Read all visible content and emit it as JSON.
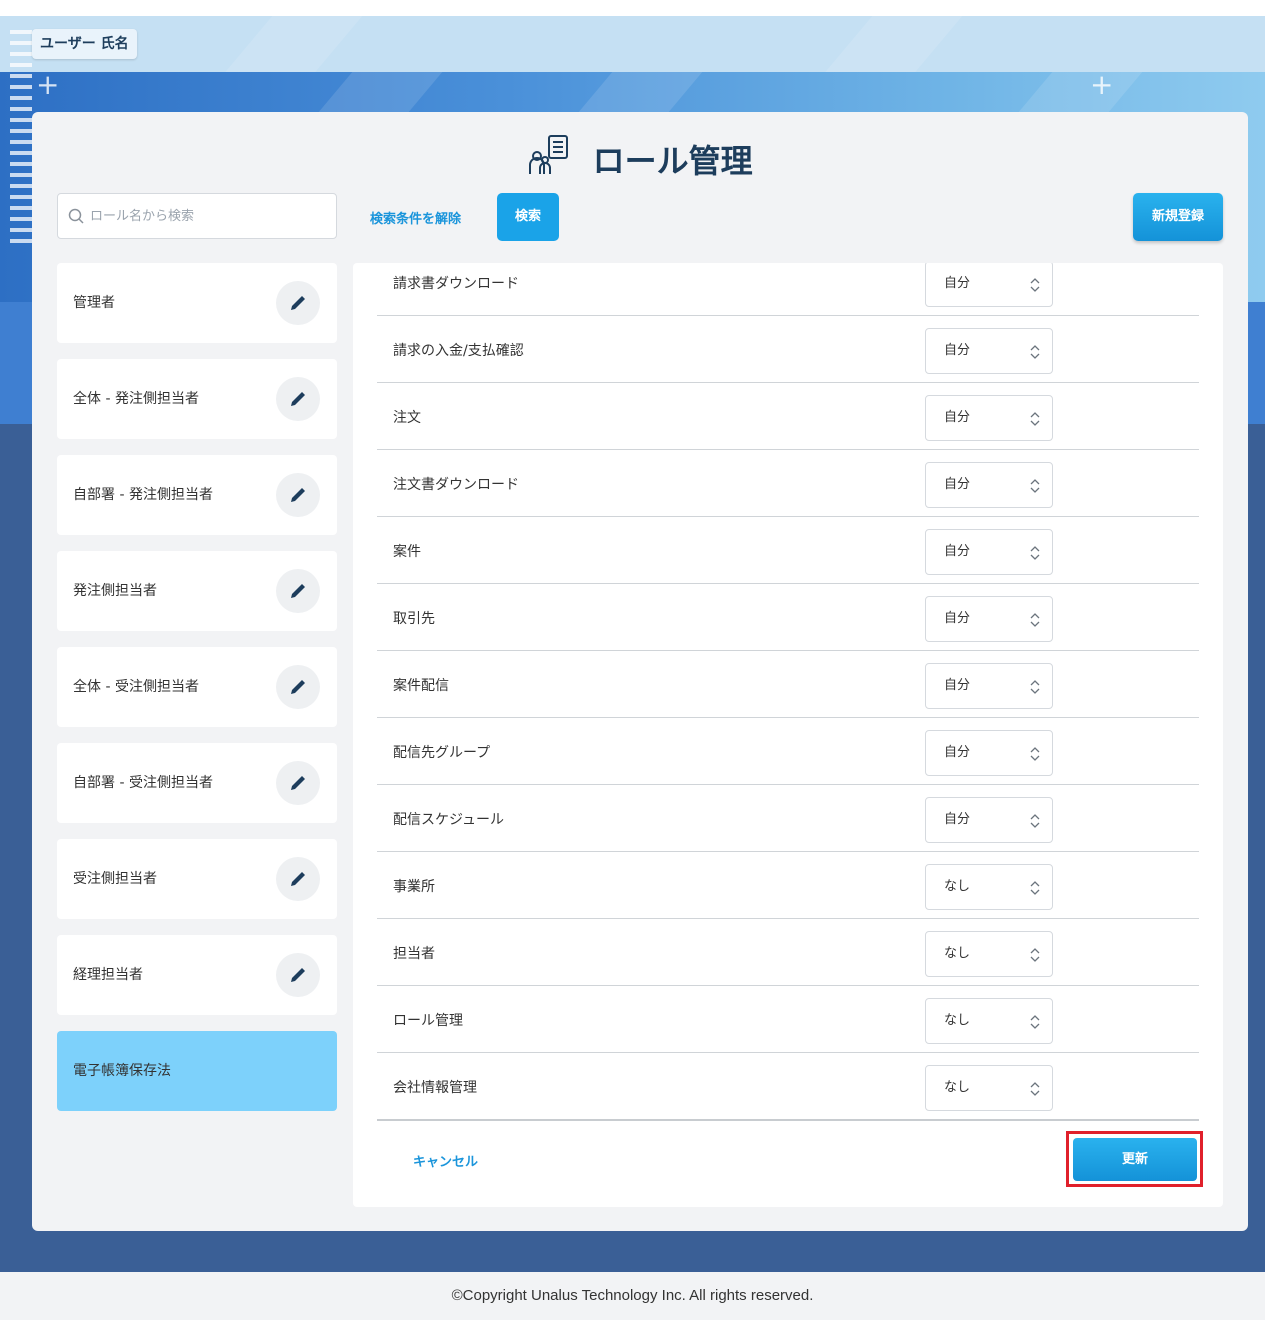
{
  "header": {
    "user_name": "ユーザー 氏名"
  },
  "page": {
    "title": "ロール管理"
  },
  "search": {
    "placeholder": "ロール名から検索",
    "value": "",
    "clear_label": "検索条件を解除",
    "search_label": "検索"
  },
  "toolbar": {
    "new_label": "新規登録"
  },
  "roles": [
    {
      "name": "管理者"
    },
    {
      "name": "全体 - 発注側担当者"
    },
    {
      "name": "自部署 - 発注側担当者"
    },
    {
      "name": "発注側担当者"
    },
    {
      "name": "全体 - 受注側担当者"
    },
    {
      "name": "自部署 - 受注側担当者"
    },
    {
      "name": "受注側担当者"
    },
    {
      "name": "経理担当者"
    },
    {
      "name": "電子帳簿保存法"
    }
  ],
  "selected_role": "電子帳簿保存法",
  "permissions": [
    {
      "label": "請求書ダウンロード",
      "value": "自分"
    },
    {
      "label": "請求の入金/支払確認",
      "value": "自分"
    },
    {
      "label": "注文",
      "value": "自分"
    },
    {
      "label": "注文書ダウンロード",
      "value": "自分"
    },
    {
      "label": "案件",
      "value": "自分"
    },
    {
      "label": "取引先",
      "value": "自分"
    },
    {
      "label": "案件配信",
      "value": "自分"
    },
    {
      "label": "配信先グループ",
      "value": "自分"
    },
    {
      "label": "配信スケジュール",
      "value": "自分"
    },
    {
      "label": "事業所",
      "value": "なし"
    },
    {
      "label": "担当者",
      "value": "なし"
    },
    {
      "label": "ロール管理",
      "value": "なし"
    },
    {
      "label": "会社情報管理",
      "value": "なし"
    }
  ],
  "actions": {
    "cancel_label": "キャンセル",
    "update_label": "更新"
  },
  "footer": {
    "copyright": "©Copyright Unalus Technology Inc. All rights reserved."
  },
  "colors": {
    "accent": "#1aa3e8",
    "selected_role": "#7dd1fb",
    "highlight_border": "#e0202b",
    "title_text": "#1d3d5c"
  }
}
